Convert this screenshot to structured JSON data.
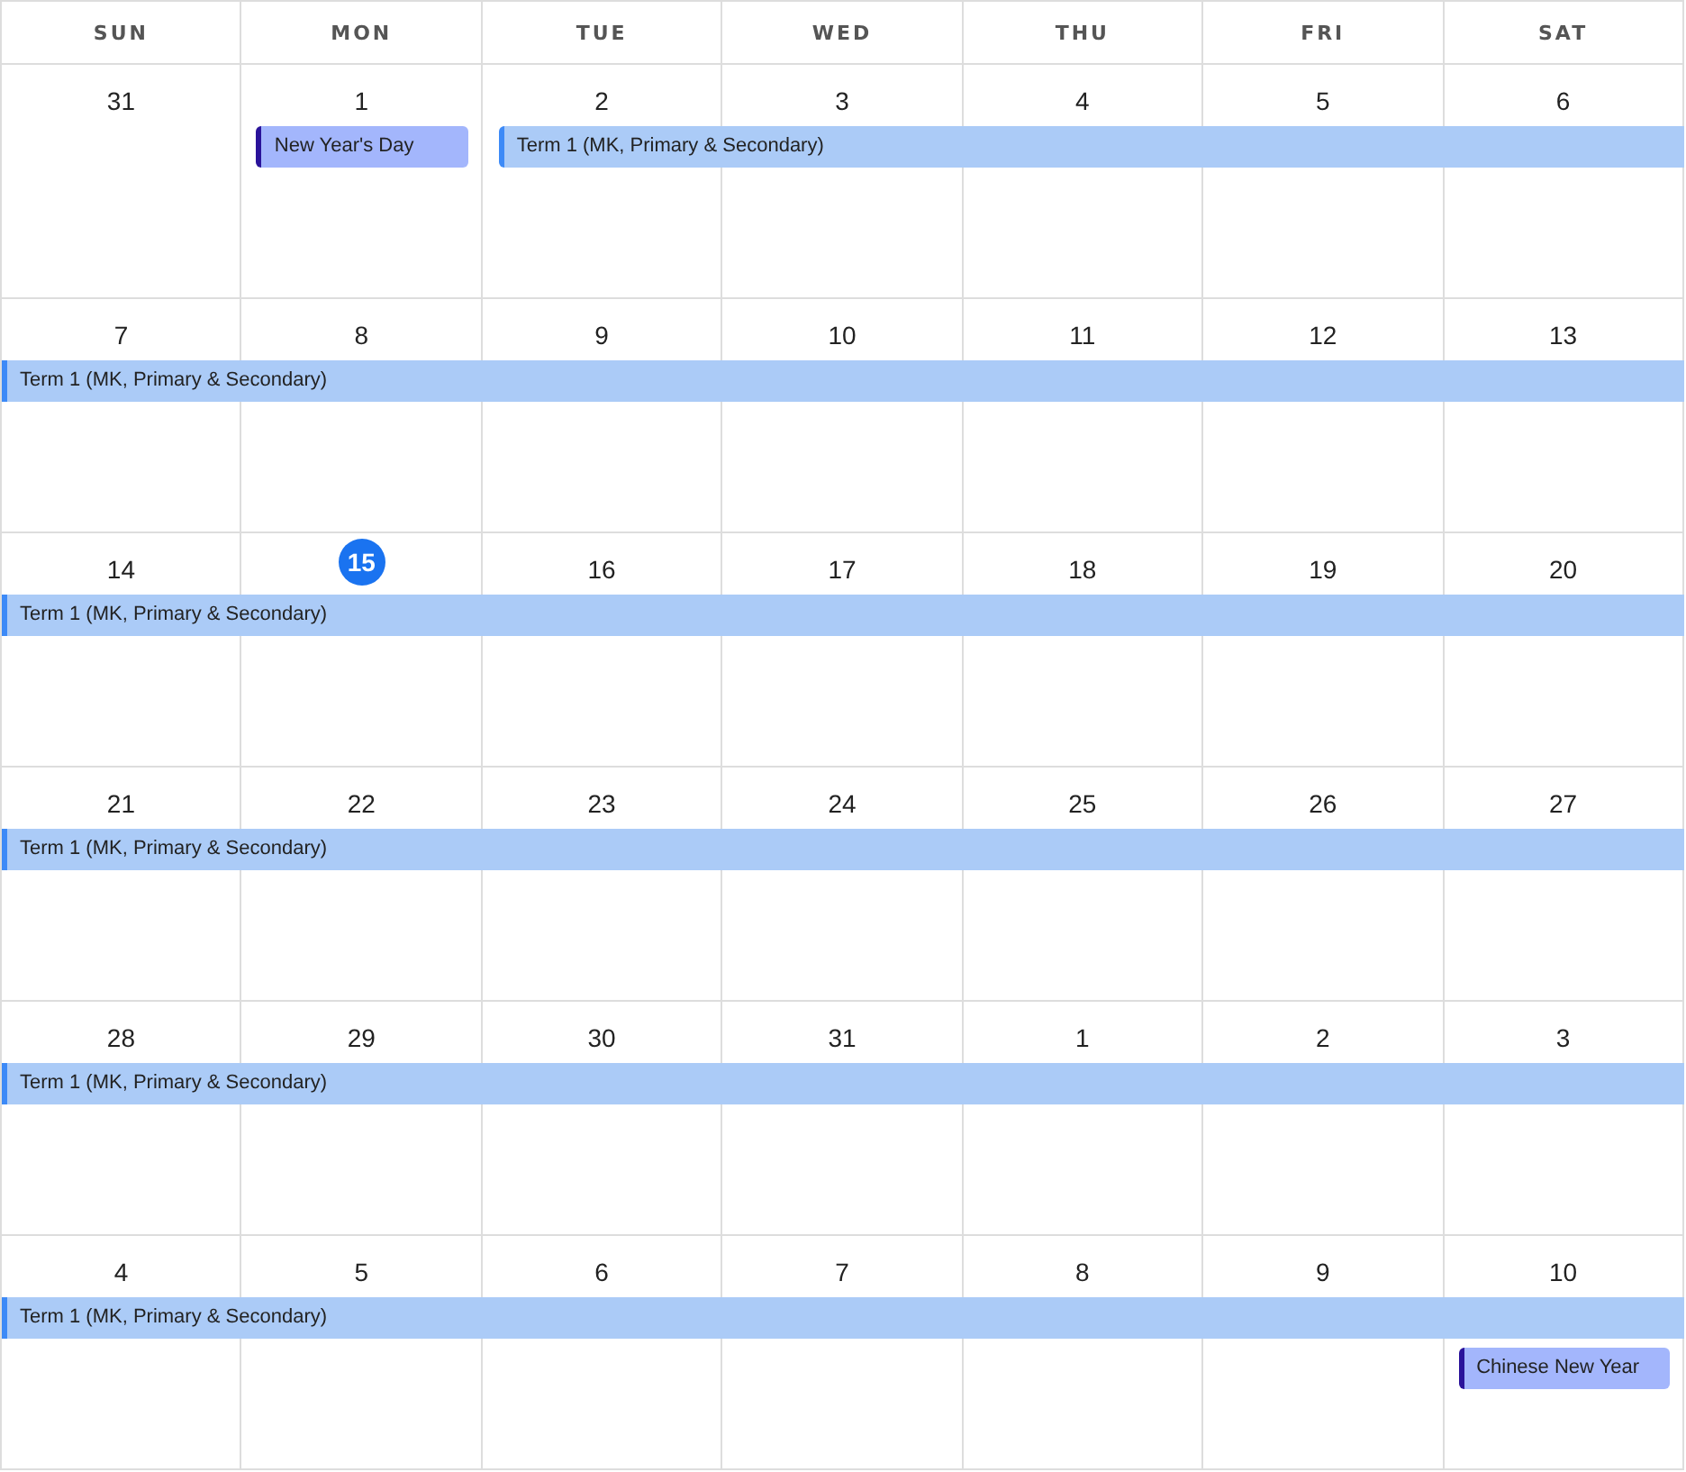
{
  "weekdays": [
    "SUN",
    "MON",
    "TUE",
    "WED",
    "THU",
    "FRI",
    "SAT"
  ],
  "weeks": [
    {
      "days": [
        {
          "number": "31",
          "today": false
        },
        {
          "number": "1",
          "today": false,
          "events": [
            {
              "title": "New Year's Day",
              "kind": "holiday"
            }
          ]
        },
        {
          "number": "2",
          "today": false,
          "events": [
            {
              "title": "Term 1 (MK, Primary & Secondary)",
              "kind": "term",
              "continued": false
            }
          ]
        },
        {
          "number": "3",
          "today": false
        },
        {
          "number": "4",
          "today": false
        },
        {
          "number": "5",
          "today": false
        },
        {
          "number": "6",
          "today": false
        }
      ]
    },
    {
      "days": [
        {
          "number": "7",
          "today": false,
          "events": [
            {
              "title": "Term 1 (MK, Primary & Secondary)",
              "kind": "term",
              "continued": true
            }
          ]
        },
        {
          "number": "8",
          "today": false
        },
        {
          "number": "9",
          "today": false
        },
        {
          "number": "10",
          "today": false
        },
        {
          "number": "11",
          "today": false
        },
        {
          "number": "12",
          "today": false
        },
        {
          "number": "13",
          "today": false
        }
      ]
    },
    {
      "days": [
        {
          "number": "14",
          "today": false,
          "events": [
            {
              "title": "Term 1 (MK, Primary & Secondary)",
              "kind": "term",
              "continued": true
            }
          ]
        },
        {
          "number": "15",
          "today": true
        },
        {
          "number": "16",
          "today": false
        },
        {
          "number": "17",
          "today": false
        },
        {
          "number": "18",
          "today": false
        },
        {
          "number": "19",
          "today": false
        },
        {
          "number": "20",
          "today": false
        }
      ]
    },
    {
      "days": [
        {
          "number": "21",
          "today": false,
          "events": [
            {
              "title": "Term 1 (MK, Primary & Secondary)",
              "kind": "term",
              "continued": true
            }
          ]
        },
        {
          "number": "22",
          "today": false
        },
        {
          "number": "23",
          "today": false
        },
        {
          "number": "24",
          "today": false
        },
        {
          "number": "25",
          "today": false
        },
        {
          "number": "26",
          "today": false
        },
        {
          "number": "27",
          "today": false
        }
      ]
    },
    {
      "days": [
        {
          "number": "28",
          "today": false,
          "events": [
            {
              "title": "Term 1 (MK, Primary & Secondary)",
              "kind": "term",
              "continued": true
            }
          ]
        },
        {
          "number": "29",
          "today": false
        },
        {
          "number": "30",
          "today": false
        },
        {
          "number": "31",
          "today": false
        },
        {
          "number": "1",
          "today": false
        },
        {
          "number": "2",
          "today": false
        },
        {
          "number": "3",
          "today": false
        }
      ]
    },
    {
      "days": [
        {
          "number": "4",
          "today": false,
          "events": [
            {
              "title": "Term 1 (MK, Primary & Secondary)",
              "kind": "term",
              "continued": true
            }
          ]
        },
        {
          "number": "5",
          "today": false
        },
        {
          "number": "6",
          "today": false
        },
        {
          "number": "7",
          "today": false
        },
        {
          "number": "8",
          "today": false
        },
        {
          "number": "9",
          "today": false
        },
        {
          "number": "10",
          "today": false,
          "events": [
            {
              "title": "Chinese New Year",
              "kind": "holiday"
            }
          ]
        }
      ]
    }
  ]
}
